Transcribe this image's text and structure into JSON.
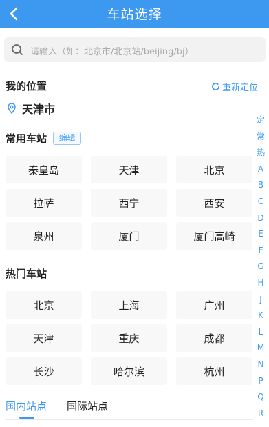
{
  "header": {
    "title": "车站选择",
    "back_icon": "chevron-left-icon"
  },
  "search": {
    "placeholder": "请输入（如：北京市/北京站/beijing/bj）",
    "icon": "search-icon"
  },
  "my_location": {
    "title": "我的位置",
    "relocate_label": "重新定位",
    "city": "天津市",
    "pin_icon": "location-pin-icon"
  },
  "common_stations": {
    "title": "常用车站",
    "edit_label": "编辑",
    "items": [
      "秦皇岛",
      "天津",
      "北京",
      "拉萨",
      "西宁",
      "西安",
      "泉州",
      "厦门",
      "厦门高崎"
    ]
  },
  "hot_stations": {
    "title": "热门车站",
    "items": [
      "北京",
      "上海",
      "广州",
      "天津",
      "重庆",
      "成都",
      "长沙",
      "哈尔滨",
      "杭州"
    ]
  },
  "tabs": [
    {
      "label": "国内站点"
    },
    {
      "label": "国际站点"
    }
  ],
  "index": [
    "定",
    "常",
    "热",
    "A",
    "B",
    "C",
    "D",
    "E",
    "F",
    "G",
    "H",
    "J",
    "K",
    "L",
    "M",
    "N",
    "P",
    "Q",
    "R"
  ],
  "colors": {
    "accent": "#3d99f0",
    "cell_bg": "#f8f8f9"
  }
}
